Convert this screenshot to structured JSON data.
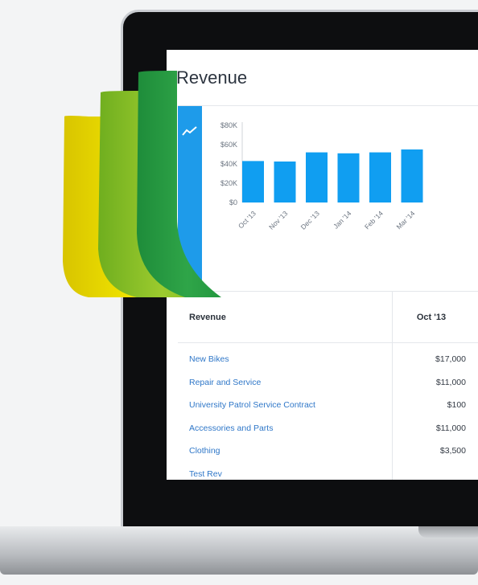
{
  "page": {
    "title": "Revenue"
  },
  "colors": {
    "accent": "#1e9bea",
    "bar": "#109ef1",
    "link": "#2f77c8"
  },
  "chart_data": {
    "type": "bar",
    "categories": [
      "Oct '13",
      "Nov '13",
      "Dec '13",
      "Jan '14",
      "Feb '14",
      "Mar '14"
    ],
    "values": [
      43000,
      42500,
      52000,
      51000,
      52000,
      55000
    ],
    "ylim": [
      0,
      80000
    ],
    "y_ticks": [
      "$0",
      "$20K",
      "$40K",
      "$60K",
      "$80K"
    ],
    "grid": false
  },
  "table": {
    "header_label": "Revenue",
    "month_header": "Oct '13",
    "rows": [
      {
        "name": "New Bikes",
        "amount": "$17,000"
      },
      {
        "name": "Repair and Service",
        "amount": "$11,000"
      },
      {
        "name": "University Patrol Service Contract",
        "amount": "$100"
      },
      {
        "name": "Accessories and Parts",
        "amount": "$11,000"
      },
      {
        "name": "Clothing",
        "amount": "$3,500"
      },
      {
        "name": "Test Rev",
        "amount": ""
      }
    ]
  },
  "icons": {
    "chart_toggle": "trend-line-icon",
    "brand": "leaf-logo-icon"
  }
}
